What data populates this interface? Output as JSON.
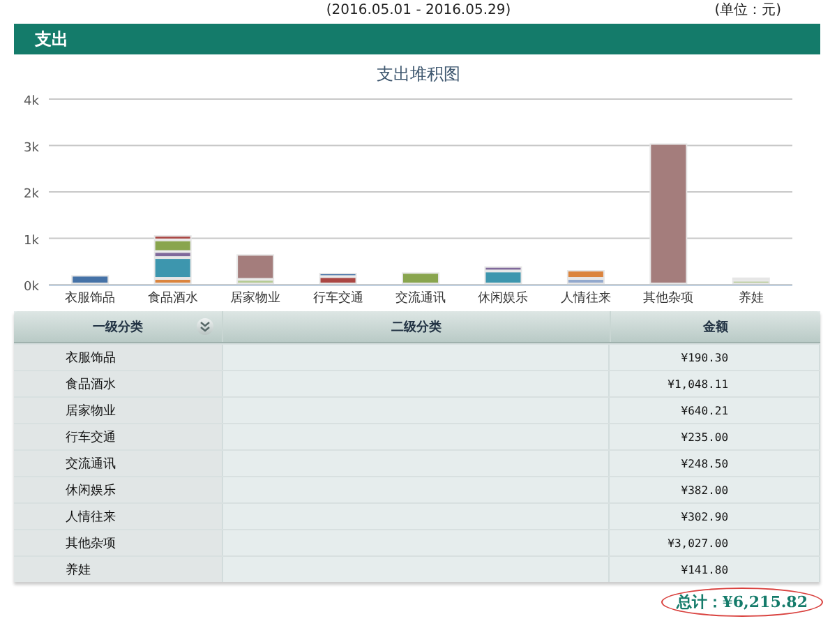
{
  "period": "(2016.05.01 - 2016.05.29)",
  "unit": "(单位：元)",
  "section_title": "支出",
  "chart": {
    "chart_data": {
      "type": "bar",
      "stacked": true,
      "grid": true,
      "title": "支出堆积图",
      "categories": [
        "衣服饰品",
        "食品酒水",
        "居家物业",
        "行车交通",
        "交流通讯",
        "休闲娱乐",
        "人情往来",
        "其他杂项",
        "养娃"
      ],
      "ylim": [
        0,
        4000
      ],
      "yticks": [
        {
          "value": 0,
          "label": "0k"
        },
        {
          "value": 1000,
          "label": "1k"
        },
        {
          "value": 2000,
          "label": "2k"
        },
        {
          "value": 3000,
          "label": "3k"
        },
        {
          "value": 4000,
          "label": "4k"
        }
      ],
      "series": [
        {
          "color": "#4572a7",
          "values": [
            190,
            null,
            null,
            80,
            null,
            null,
            null,
            null,
            null
          ]
        },
        {
          "color": "#aa4643",
          "values": [
            null,
            100,
            null,
            160,
            null,
            null,
            null,
            null,
            null
          ]
        },
        {
          "color": "#89a54e",
          "values": [
            null,
            250,
            null,
            null,
            250,
            null,
            null,
            null,
            null
          ]
        },
        {
          "color": "#80699b",
          "values": [
            null,
            130,
            null,
            null,
            null,
            100,
            null,
            null,
            null
          ]
        },
        {
          "color": "#3d96ae",
          "values": [
            null,
            450,
            null,
            null,
            null,
            280,
            null,
            null,
            null
          ]
        },
        {
          "color": "#db843d",
          "values": [
            null,
            120,
            null,
            null,
            null,
            null,
            180,
            null,
            null
          ]
        },
        {
          "color": "#92a8cd",
          "values": [
            null,
            null,
            null,
            null,
            null,
            null,
            120,
            null,
            60
          ]
        },
        {
          "color": "#a47d7c",
          "values": [
            null,
            null,
            540,
            null,
            null,
            null,
            null,
            3030,
            null
          ]
        },
        {
          "color": "#b5ca92",
          "values": [
            null,
            null,
            100,
            null,
            null,
            null,
            null,
            null,
            80
          ]
        }
      ]
    }
  },
  "table": {
    "columns": [
      "一级分类",
      "二级分类",
      "金额"
    ],
    "rows": [
      {
        "category": "衣服饰品",
        "amount": "¥190.30"
      },
      {
        "category": "食品酒水",
        "amount": "¥1,048.11"
      },
      {
        "category": "居家物业",
        "amount": "¥640.21"
      },
      {
        "category": "行车交通",
        "amount": "¥235.00"
      },
      {
        "category": "交流通讯",
        "amount": "¥248.50"
      },
      {
        "category": "休闲娱乐",
        "amount": "¥382.00"
      },
      {
        "category": "人情往来",
        "amount": "¥302.90"
      },
      {
        "category": "其他杂项",
        "amount": "¥3,027.00"
      },
      {
        "category": "养娃",
        "amount": "¥141.80"
      }
    ]
  },
  "total": "总计：¥6,215.82"
}
